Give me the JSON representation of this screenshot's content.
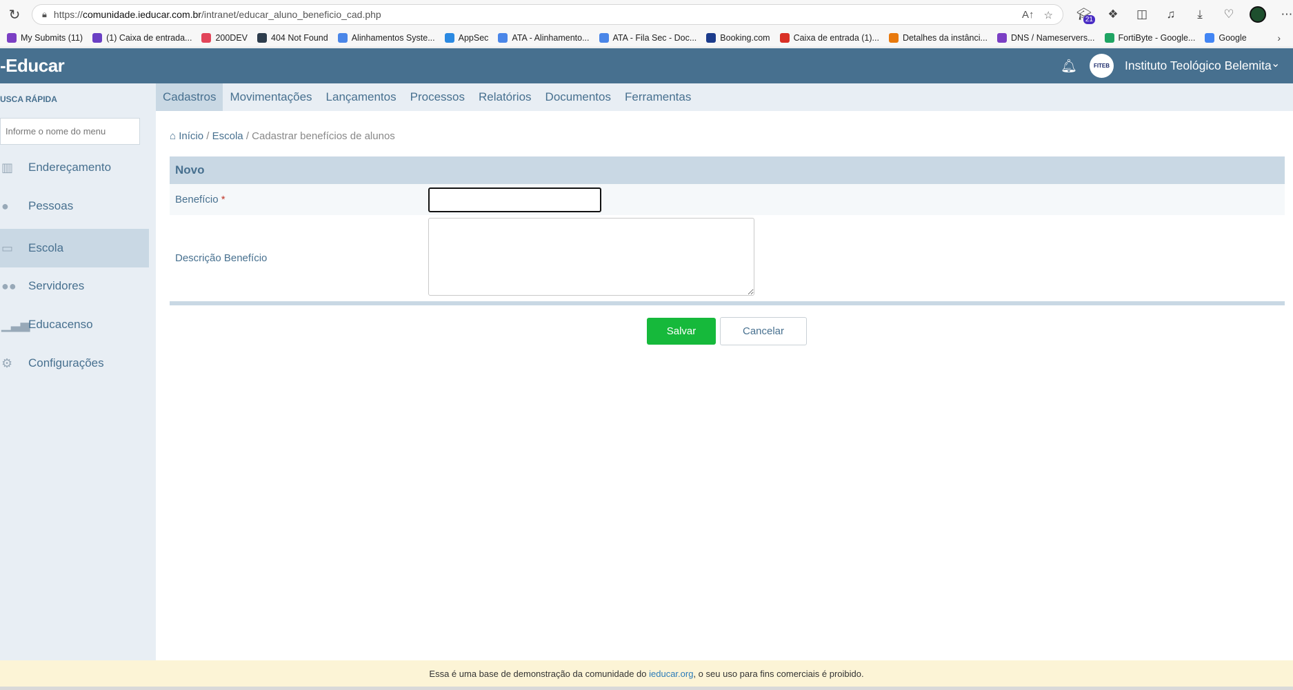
{
  "browser": {
    "url_scheme": "https://",
    "url_host": "comunidade.ieducar.com.br",
    "url_path": "/intranet/educar_aluno_beneficio_cad.php",
    "extension_badge": "21"
  },
  "bookmarks": [
    {
      "label": "My Submits (11)",
      "color": "#7b3fc4"
    },
    {
      "label": "(1) Caixa de entrada...",
      "color": "#6a3fc4"
    },
    {
      "label": "200DEV",
      "color": "#e2455a"
    },
    {
      "label": "404 Not Found",
      "color": "#2d3d4d"
    },
    {
      "label": "Alinhamentos Syste...",
      "color": "#4a86e8"
    },
    {
      "label": "AppSec",
      "color": "#2b8ae2"
    },
    {
      "label": "ATA - Alinhamento...",
      "color": "#4a86e8"
    },
    {
      "label": "ATA - Fila Sec - Doc...",
      "color": "#4a86e8"
    },
    {
      "label": "Booking.com",
      "color": "#1c3c8c"
    },
    {
      "label": "Caixa de entrada (1)...",
      "color": "#d93025"
    },
    {
      "label": "Detalhes da instânci...",
      "color": "#e8790d"
    },
    {
      "label": "DNS / Nameservers...",
      "color": "#7b3fc4"
    },
    {
      "label": "FortiByte - Google...",
      "color": "#1fa463"
    },
    {
      "label": "Google",
      "color": "#4285f4"
    }
  ],
  "header": {
    "logo": "-Educar",
    "avatar_text": "FITEB",
    "institution": "Instituto Teológico Belemita"
  },
  "sidebar": {
    "quick_search_title": "USCA RÁPIDA",
    "search_placeholder": "Informe o nome do menu",
    "items": [
      {
        "label": "Endereçamento",
        "icon": "map-icon"
      },
      {
        "label": "Pessoas",
        "icon": "person-icon"
      },
      {
        "label": "Escola",
        "icon": "book-icon",
        "active": true
      },
      {
        "label": "Servidores",
        "icon": "users-icon"
      },
      {
        "label": "Educacenso",
        "icon": "bar-chart-icon"
      },
      {
        "label": "Configurações",
        "icon": "gear-icon"
      }
    ]
  },
  "nav": {
    "items": [
      "Cadastros",
      "Movimentações",
      "Lançamentos",
      "Processos",
      "Relatórios",
      "Documentos",
      "Ferramentas"
    ],
    "active": "Cadastros"
  },
  "breadcrumb": {
    "home": "Início",
    "section": "Escola",
    "current": "Cadastrar benefícios de alunos"
  },
  "form": {
    "header": "Novo",
    "beneficio_label": "Benefício",
    "required_mark": "*",
    "beneficio_value": "",
    "descricao_label": "Descrição Benefício",
    "descricao_value": "",
    "save_label": "Salvar",
    "cancel_label": "Cancelar"
  },
  "footer": {
    "text_before": "Essa é uma base de demonstração da comunidade do ",
    "link": "ieducar.org",
    "text_after": ", o seu uso para fins comerciais é proibido."
  }
}
